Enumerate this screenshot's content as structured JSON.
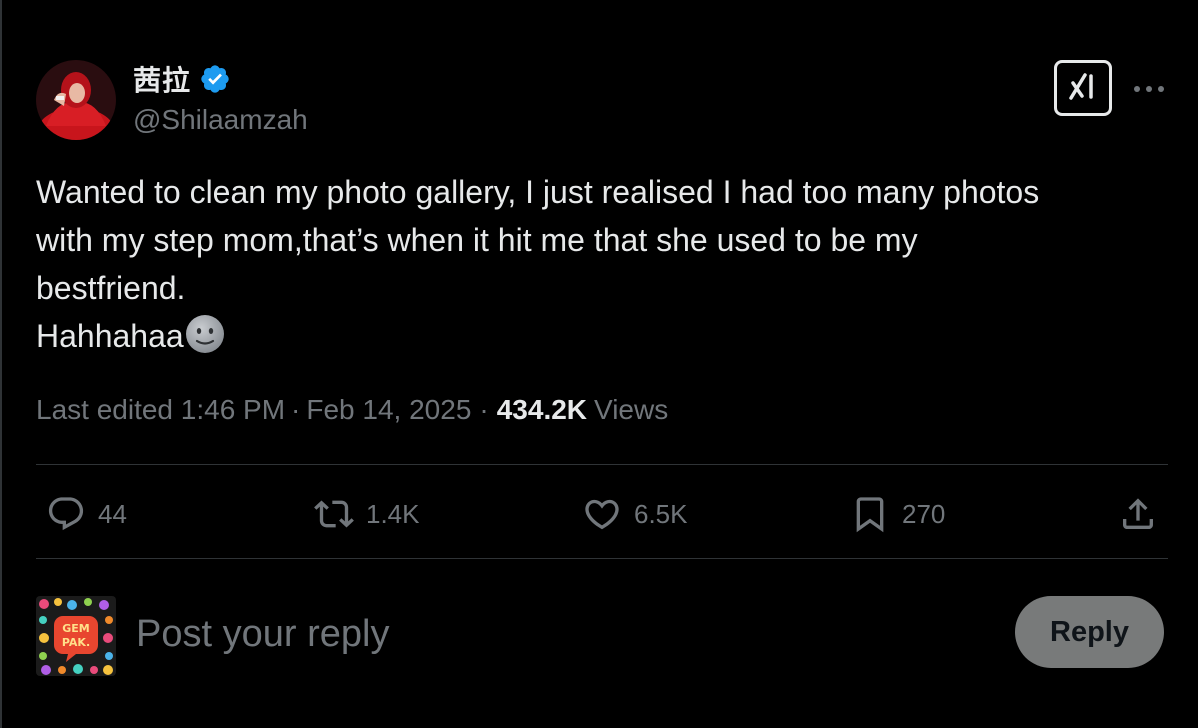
{
  "author": {
    "display_name": "茜拉",
    "handle": "@Shilaamzah",
    "verified": true,
    "verified_color": "#1d9bf0"
  },
  "tweet": {
    "text": "Wanted to clean my photo gallery, I just realised I had too many photos\nwith my step mom,that’s when it hit me that she used to be my\nbestfriend.\nHahhahaa",
    "emoji": "neutral-face-emoji"
  },
  "meta": {
    "edited_label": "Last edited 1:46 PM",
    "separator": "·",
    "date": "Feb 14, 2025",
    "views_count": "434.2K",
    "views_label": "Views"
  },
  "actions": {
    "replies": "44",
    "reposts": "1.4K",
    "likes": "6.5K",
    "bookmarks": "270"
  },
  "composer": {
    "placeholder": "Post your reply",
    "reply_label": "Reply"
  },
  "icons": {
    "header": [
      "grok-icon",
      "more-icon"
    ],
    "actions": [
      "reply-icon",
      "repost-icon",
      "like-icon",
      "bookmark-icon",
      "share-icon"
    ]
  },
  "colors": {
    "background": "#000000",
    "text": "#e7e9ea",
    "secondary_text": "#71767b",
    "divider": "#2f3336",
    "reply_button_bg": "#787a7a"
  }
}
